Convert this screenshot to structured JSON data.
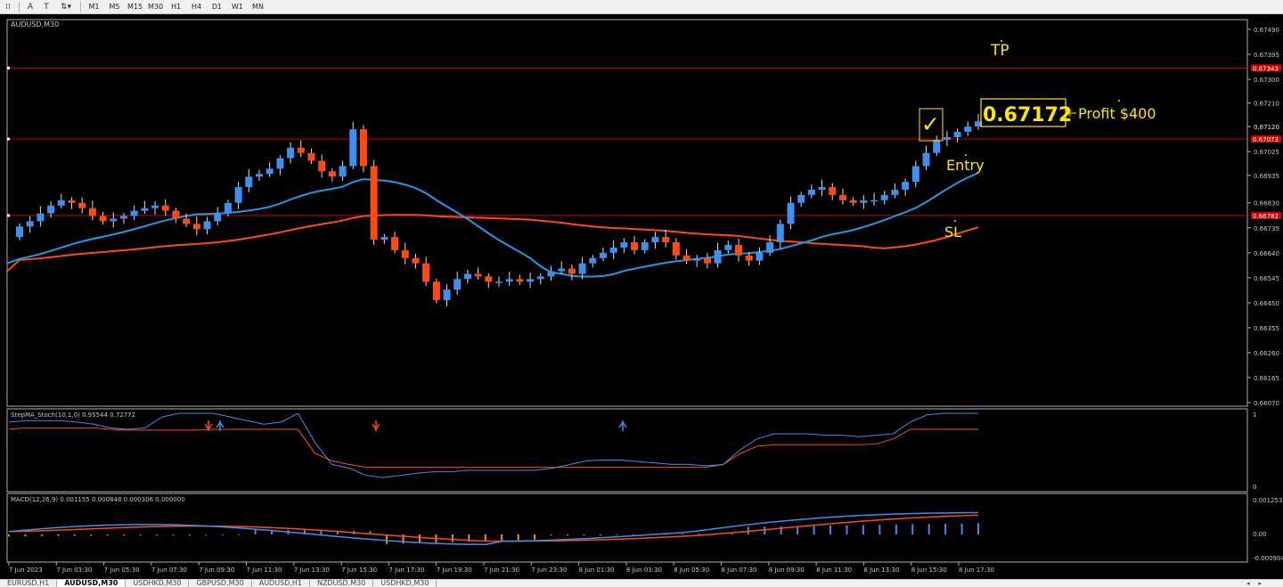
{
  "toolbar": {
    "tools": [
      {
        "name": "grid-tool-icon",
        "glyph": "⁞⁞"
      },
      {
        "name": "text-tool-icon",
        "glyph": "A"
      },
      {
        "name": "text-label-tool-icon",
        "glyph": "T"
      },
      {
        "name": "arrows-tool-icon",
        "glyph": "⇅▾"
      }
    ],
    "timeframes": [
      "M1",
      "M5",
      "M15",
      "M30",
      "H1",
      "H4",
      "D1",
      "W1",
      "MN"
    ]
  },
  "tabs": [
    {
      "label": "EURUSD,H1",
      "active": false
    },
    {
      "label": "AUDUSD,M30",
      "active": true
    },
    {
      "label": "USDHKD,M30",
      "active": false
    },
    {
      "label": "GBPUSD,M30",
      "active": false
    },
    {
      "label": "AUDUSD,H1",
      "active": false
    },
    {
      "label": "NZDUSD,M30",
      "active": false
    },
    {
      "label": "USDHKD,M30",
      "active": false
    }
  ],
  "tab_nav": "◂▸",
  "main_chart": {
    "title": "AUDUSD,M30",
    "price_ticks": [
      "0.67490",
      "0.67395",
      "0.67300",
      "0.67210",
      "0.67120",
      "0.67025",
      "0.66935",
      "0.66830",
      "0.66735",
      "0.66640",
      "0.66545",
      "0.66450",
      "0.66355",
      "0.66260",
      "0.66165",
      "0.66070"
    ],
    "level_tags": [
      "0.67343",
      "0.67073",
      "0.66782"
    ],
    "annotations": {
      "tp": "TP",
      "entry": "Entry",
      "sl": "SL",
      "price_box": "0.67172",
      "profit": "Profit $400",
      "check": "✓"
    }
  },
  "stoch_panel": {
    "title": "StepMA_Stoch(10,1,0) 0.95544 0.72772",
    "ticks": [
      "1",
      "0"
    ]
  },
  "macd_panel": {
    "title": "MACD(12,26,9) 0.001155 0.000848 0.000306 0.000000",
    "ticks": [
      "0.001253",
      "0.00",
      "-0.000904"
    ]
  },
  "time_labels": [
    "7 Jun 2023",
    "7 Jun 03:30",
    "7 Jun 05:30",
    "7 Jun 07:30",
    "7 Jun 09:30",
    "7 Jun 11:30",
    "7 Jun 13:30",
    "7 Jun 15:30",
    "7 Jun 17:30",
    "7 Jun 19:30",
    "7 Jun 21:30",
    "7 Jun 23:30",
    "8 Jun 01:30",
    "8 Jun 03:30",
    "8 Jun 05:30",
    "8 Jun 07:30",
    "8 Jun 09:30",
    "8 Jun 11:30",
    "8 Jun 13:30",
    "8 Jun 15:30",
    "8 Jun 17:30"
  ],
  "colors": {
    "bull": "#3d8ff2",
    "bear": "#ff4a12",
    "level_line": "#cc0000",
    "ma_fast": "#1e9be8",
    "ma_slow": "#ff4a12",
    "annotation": "#ffe600",
    "axis_text": "#c8c8c8"
  }
}
